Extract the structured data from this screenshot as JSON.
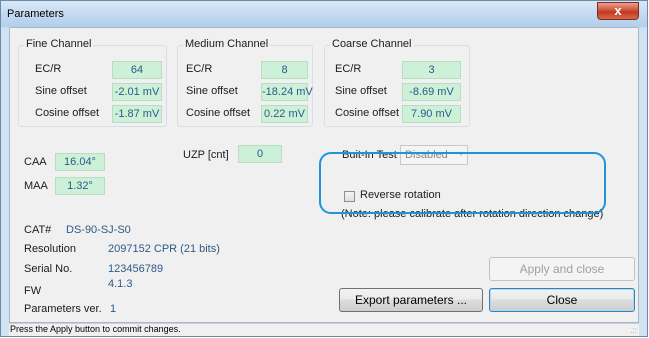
{
  "window": {
    "title": "Parameters",
    "close_glyph": "x",
    "status_text": "Press the Apply button to commit changes.",
    "grip_glyph": ".::"
  },
  "fine": {
    "title": "Fine Channel",
    "ecr_label": "EC/R",
    "ecr_value": "64",
    "sine_label": "Sine offset",
    "sine_value": "-2.01 mV",
    "cos_label": "Cosine offset",
    "cos_value": "-1.87 mV"
  },
  "medium": {
    "title": "Medium Channel",
    "ecr_label": "EC/R",
    "ecr_value": "8",
    "sine_label": "Sine offset",
    "sine_value": "-18.24 mV",
    "cos_label": "Cosine offset",
    "cos_value": "0.22 mV"
  },
  "coarse": {
    "title": "Coarse Channel",
    "ecr_label": "EC/R",
    "ecr_value": "3",
    "sine_label": "Sine offset",
    "sine_value": "-8.69 mV",
    "cos_label": "Cosine offset",
    "cos_value": "7.90 mV"
  },
  "caa": {
    "label": "CAA",
    "value": "16.04°"
  },
  "maa": {
    "label": "MAA",
    "value": "1.32°"
  },
  "uzp": {
    "label": "UZP [cnt]",
    "value": "0"
  },
  "bit": {
    "label": "Buit-In Test",
    "selected": "Disabled"
  },
  "rotation": {
    "checkbox_label": "Reverse rotation",
    "checked": false,
    "note": "(Note: please calibrate after rotation direction change)"
  },
  "info": {
    "cat_label": "CAT#",
    "cat_value": "DS-90-SJ-S0",
    "resolution_label": "Resolution",
    "resolution_value": "2097152 CPR (21 bits)",
    "serial_label": "Serial No.",
    "serial_value": "123456789",
    "fw_label": "FW",
    "fw_value": "4.1.3",
    "params_label": "Parameters ver.",
    "params_value": "1"
  },
  "buttons": {
    "apply_close": "Apply and close",
    "export": "Export parameters ...",
    "close": "Close"
  },
  "colors": {
    "value_field_bg": "#ccf0d8",
    "value_text": "#2e5a86",
    "callout_border": "#1f95d6"
  }
}
